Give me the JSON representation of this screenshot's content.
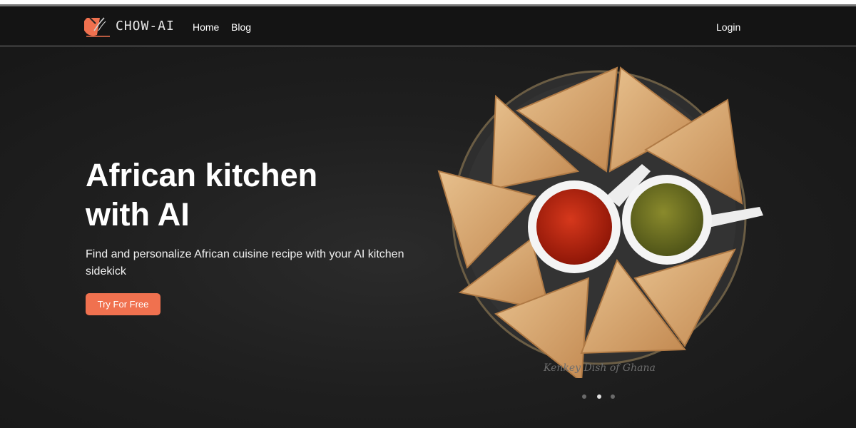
{
  "brand": {
    "name": "CHOW-AI",
    "logo_icon": "chef-knife-logo-icon",
    "accent_color": "#f0714f"
  },
  "nav": {
    "home": "Home",
    "blog": "Blog",
    "login": "Login"
  },
  "hero": {
    "headline_line1": "African kitchen",
    "headline_line2": "with AI",
    "subtext": "Find and personalize African cuisine recipe with your AI kitchen sidekick",
    "cta_label": "Try For Free",
    "image_caption": "Kenkey Dish of Ghana"
  },
  "carousel": {
    "slides": 3,
    "active_index": 1
  }
}
